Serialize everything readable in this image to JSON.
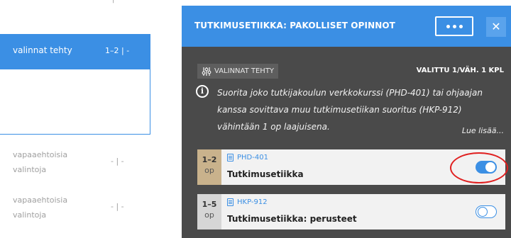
{
  "left_panel": {
    "top_fragment": "|",
    "selected_row": {
      "label": "valinnat tehty",
      "count": "1–2 | -"
    },
    "rows": [
      {
        "label": "vapaaehtoisia valintoja",
        "count": "- | -"
      },
      {
        "label": "vapaaehtoisia valintoja",
        "count": "- | -"
      }
    ]
  },
  "modal": {
    "title": "TUTKIMUSETIIKKA: PAKOLLISET OPINNOT",
    "more_icon": "more-dots-icon",
    "close_icon": "close-icon",
    "close_glyph": "✕",
    "status_chip": {
      "icon": "sliders-icon",
      "label": "VALINNAT TEHTY"
    },
    "selected_count": "VALITTU 1/VÄH. 1 KPL",
    "info_icon": "info-icon",
    "info_glyph": "i",
    "info_text": "Suorita joko tutkijakoulun verkkokurssi (PHD-401) tai ohjaajan kanssa sovittava muu tutkimusetiikan suoritus (HKP-912) vähintään 1 op laajuisena.",
    "read_more": "Lue lisää...",
    "courses": [
      {
        "credits": "1–2",
        "unit": "op",
        "code": "PHD-401",
        "name": "Tutkimusetiikka",
        "selected": true,
        "credit_bg": "#c9b28c"
      },
      {
        "credits": "1–5",
        "unit": "op",
        "code": "HKP-912",
        "name": "Tutkimusetiikka: perusteet",
        "selected": false,
        "credit_bg": "#d6d6d6"
      }
    ]
  },
  "colors": {
    "accent": "#3b8fe4",
    "modal_bg": "#4a4a4a",
    "annotation": "#e02020"
  }
}
